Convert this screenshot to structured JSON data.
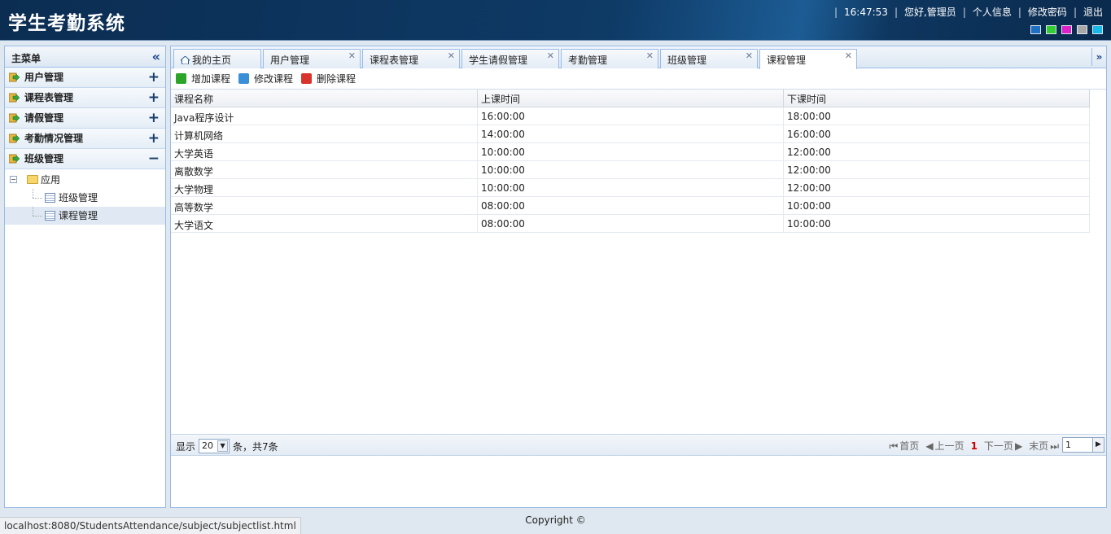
{
  "header": {
    "app_title": "学生考勤系统",
    "time": "16:47:53",
    "greeting": "您好,管理员",
    "links": {
      "profile": "个人信息",
      "password": "修改密码",
      "logout": "退出"
    },
    "theme_colors": [
      "#1f6fc2",
      "#33cc33",
      "#dd22cc",
      "#a8a8a8",
      "#18b8e8"
    ]
  },
  "sidebar": {
    "title": "主菜单",
    "items": [
      {
        "label": "用户管理",
        "toggle": "+"
      },
      {
        "label": "课程表管理",
        "toggle": "+"
      },
      {
        "label": "请假管理",
        "toggle": "+"
      },
      {
        "label": "考勤情况管理",
        "toggle": "+"
      },
      {
        "label": "班级管理",
        "toggle": "−"
      }
    ],
    "tree": {
      "root": "应用",
      "root_toggle": "−",
      "children": [
        "班级管理",
        "课程管理"
      ]
    }
  },
  "tabs": [
    {
      "label": "我的主页",
      "closable": false
    },
    {
      "label": "用户管理",
      "closable": true
    },
    {
      "label": "课程表管理",
      "closable": true
    },
    {
      "label": "学生请假管理",
      "closable": true
    },
    {
      "label": "考勤管理",
      "closable": true
    },
    {
      "label": "班级管理",
      "closable": true
    },
    {
      "label": "课程管理",
      "closable": true,
      "active": true
    }
  ],
  "toolbar": {
    "add": "增加课程",
    "edit": "修改课程",
    "delete": "删除课程"
  },
  "grid": {
    "columns": [
      "课程名称",
      "上课时间",
      "下课时间"
    ],
    "rows": [
      [
        "Java程序设计",
        "16:00:00",
        "18:00:00"
      ],
      [
        "计算机网络",
        "14:00:00",
        "16:00:00"
      ],
      [
        "大学英语",
        "10:00:00",
        "12:00:00"
      ],
      [
        "离散数学",
        "10:00:00",
        "12:00:00"
      ],
      [
        "大学物理",
        "10:00:00",
        "12:00:00"
      ],
      [
        "高等数学",
        "08:00:00",
        "10:00:00"
      ],
      [
        "大学语文",
        "08:00:00",
        "10:00:00"
      ]
    ]
  },
  "pager": {
    "show": "显示",
    "page_size": "20",
    "total": "条，共7条",
    "first": "首页",
    "prev": "上一页",
    "current": "1",
    "next": "下一页",
    "last": "末页",
    "page_input": "1"
  },
  "footer": {
    "copyright": "Copyright ©"
  },
  "statusbar": {
    "url": "localhost:8080/StudentsAttendance/subject/subjectlist.html"
  }
}
